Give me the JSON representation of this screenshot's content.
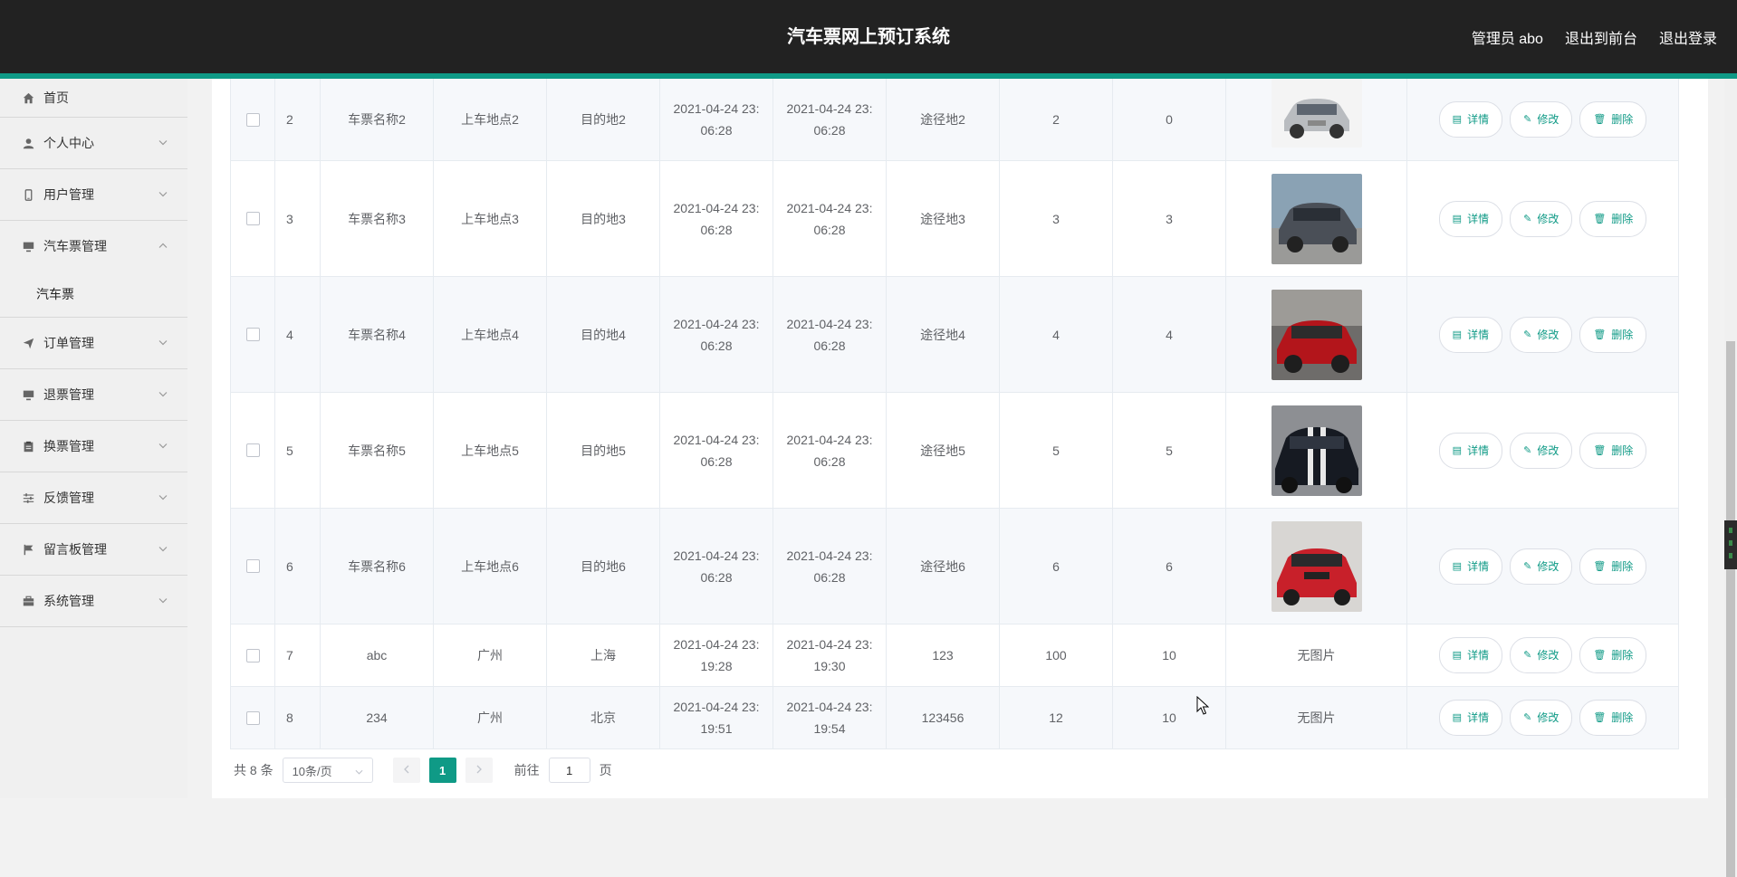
{
  "header": {
    "title": "汽车票网上预订系统",
    "admin": "管理员 abo",
    "to_front": "退出到前台",
    "logout": "退出登录"
  },
  "sidebar": {
    "items": [
      {
        "label": "首页",
        "icon": "home-icon"
      },
      {
        "label": "个人中心",
        "icon": "user-icon"
      },
      {
        "label": "用户管理",
        "icon": "phone-icon"
      },
      {
        "label": "汽车票管理",
        "icon": "monitor-icon"
      },
      {
        "label": "订单管理",
        "icon": "send-icon"
      },
      {
        "label": "退票管理",
        "icon": "monitor-icon"
      },
      {
        "label": "换票管理",
        "icon": "clipboard-icon"
      },
      {
        "label": "反馈管理",
        "icon": "sliders-icon"
      },
      {
        "label": "留言板管理",
        "icon": "flag-icon"
      },
      {
        "label": "系统管理",
        "icon": "briefcase-icon"
      }
    ],
    "submenu": "汽车票"
  },
  "rows": [
    {
      "id": "2",
      "name": "车票名称2",
      "from": "上车地点2",
      "to": "目的地2",
      "t1a": "2021-04-24 23:",
      "t1b": "06:28",
      "t2a": "2021-04-24 23:",
      "t2b": "06:28",
      "via": "途径地2",
      "price": "2",
      "seats": "0",
      "image": "no-image-placeholder-silver-suv",
      "image_text": ""
    },
    {
      "id": "3",
      "name": "车票名称3",
      "from": "上车地点3",
      "to": "目的地3",
      "t1a": "2021-04-24 23:",
      "t1b": "06:28",
      "t2a": "2021-04-24 23:",
      "t2b": "06:28",
      "via": "途径地3",
      "price": "3",
      "seats": "3",
      "image": "gray-suv",
      "image_text": ""
    },
    {
      "id": "4",
      "name": "车票名称4",
      "from": "上车地点4",
      "to": "目的地4",
      "t1a": "2021-04-24 23:",
      "t1b": "06:28",
      "t2a": "2021-04-24 23:",
      "t2b": "06:28",
      "via": "途径地4",
      "price": "4",
      "seats": "4",
      "image": "red-suv-motion",
      "image_text": ""
    },
    {
      "id": "5",
      "name": "车票名称5",
      "from": "上车地点5",
      "to": "目的地5",
      "t1a": "2021-04-24 23:",
      "t1b": "06:28",
      "t2a": "2021-04-24 23:",
      "t2b": "06:28",
      "via": "途径地5",
      "price": "5",
      "seats": "5",
      "image": "black-muscle-car",
      "image_text": ""
    },
    {
      "id": "6",
      "name": "车票名称6",
      "from": "上车地点6",
      "to": "目的地6",
      "t1a": "2021-04-24 23:",
      "t1b": "06:28",
      "t2a": "2021-04-24 23:",
      "t2b": "06:28",
      "via": "途径地6",
      "price": "6",
      "seats": "6",
      "image": "red-crossover",
      "image_text": ""
    },
    {
      "id": "7",
      "name": "abc",
      "from": "广州",
      "to": "上海",
      "t1a": "2021-04-24 23:",
      "t1b": "19:28",
      "t2a": "2021-04-24 23:",
      "t2b": "19:30",
      "via": "123",
      "price": "100",
      "seats": "10",
      "image": "",
      "image_text": "无图片"
    },
    {
      "id": "8",
      "name": "234",
      "from": "广州",
      "to": "北京",
      "t1a": "2021-04-24 23:",
      "t1b": "19:51",
      "t2a": "2021-04-24 23:",
      "t2b": "19:54",
      "via": "123456",
      "price": "12",
      "seats": "10",
      "image": "",
      "image_text": "无图片"
    }
  ],
  "buttons": {
    "detail": "详情",
    "edit": "修改",
    "delete": "删除"
  },
  "pagination": {
    "total": "共 8 条",
    "page_size": "10条/页",
    "current": "1",
    "goto_label": "前往",
    "goto_value": "1",
    "page_suffix": "页"
  },
  "colors": {
    "accent": "#0f9a86",
    "header_bg": "#222222"
  }
}
